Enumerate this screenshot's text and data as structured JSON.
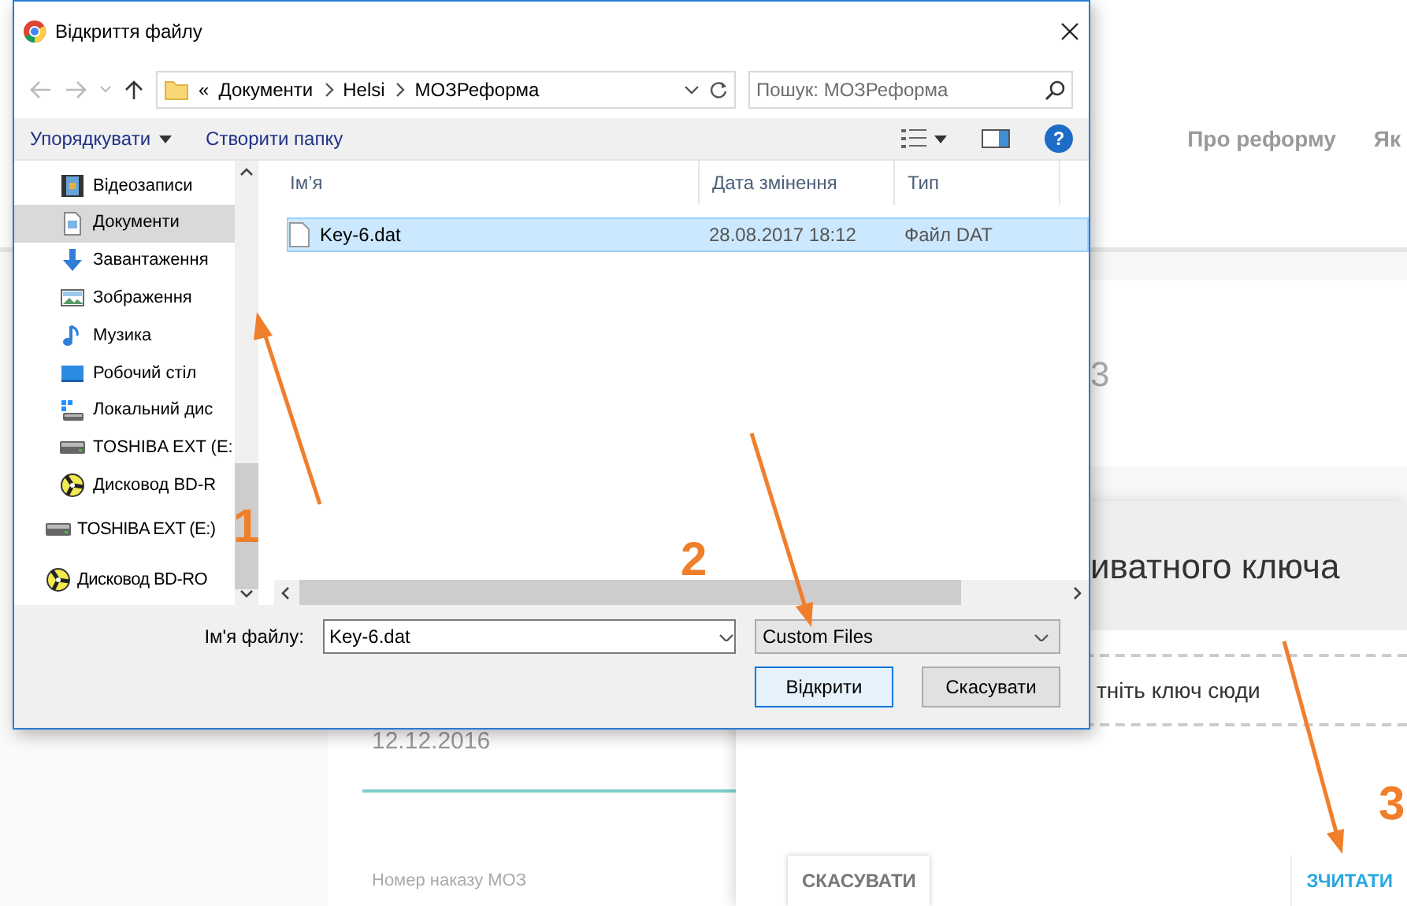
{
  "dialog": {
    "title": "Відкриття файлу",
    "address": {
      "overflow": "«",
      "path": [
        "Документи",
        "Helsi",
        "МОЗРеформа"
      ]
    },
    "search": {
      "placeholder": "Пошук: МОЗРеформа"
    },
    "toolbar": {
      "organize": "Упорядкувати",
      "new_folder": "Створити папку",
      "help": "?"
    },
    "nav": {
      "this_pc_children": [
        {
          "label": "Відеозаписи",
          "kind": "video",
          "selected": false
        },
        {
          "label": "Документи",
          "kind": "docs",
          "selected": true
        },
        {
          "label": "Завантаження",
          "kind": "download",
          "selected": false
        },
        {
          "label": "Зображення",
          "kind": "pictures",
          "selected": false
        },
        {
          "label": "Музика",
          "kind": "music",
          "selected": false
        },
        {
          "label": "Робочий стіл",
          "kind": "desktop",
          "selected": false
        },
        {
          "label": "Локальний дис",
          "kind": "localdisk",
          "selected": false
        },
        {
          "label": "TOSHIBA EXT (E:",
          "kind": "drive",
          "selected": false
        },
        {
          "label": "Дисковод BD-R",
          "kind": "optical",
          "selected": false
        }
      ],
      "top_level": [
        {
          "label": "TOSHIBA EXT (E:)",
          "kind": "drive",
          "selected": false
        },
        {
          "label": "Дисковод BD-RO",
          "kind": "optical",
          "selected": false
        }
      ]
    },
    "columns": [
      "Ім’я",
      "Дата змінення",
      "Тип"
    ],
    "files": [
      {
        "name": "Key-6.dat",
        "modified": "28.08.2017 18:12",
        "type": "Файл DAT",
        "selected": true
      }
    ],
    "file_name_label": "Ім'я файлу:",
    "file_name": "Key-6.dat",
    "filter": "Custom Files",
    "buttons": {
      "open": "Відкрити",
      "cancel": "Скасувати"
    }
  },
  "web_page": {
    "nav_links": [
      "Про реформу",
      "Як"
    ],
    "card_heading": "3",
    "date": "12.12.2016",
    "order_label": "Номер наказу МОЗ",
    "modal": {
      "title": "иватного ключа",
      "drop_hint": "тніть ключ сюди",
      "cancel": "СКАСУВАТИ",
      "read": "ЗЧИТАТИ"
    }
  },
  "annotations": [
    "1",
    "2",
    "3"
  ]
}
